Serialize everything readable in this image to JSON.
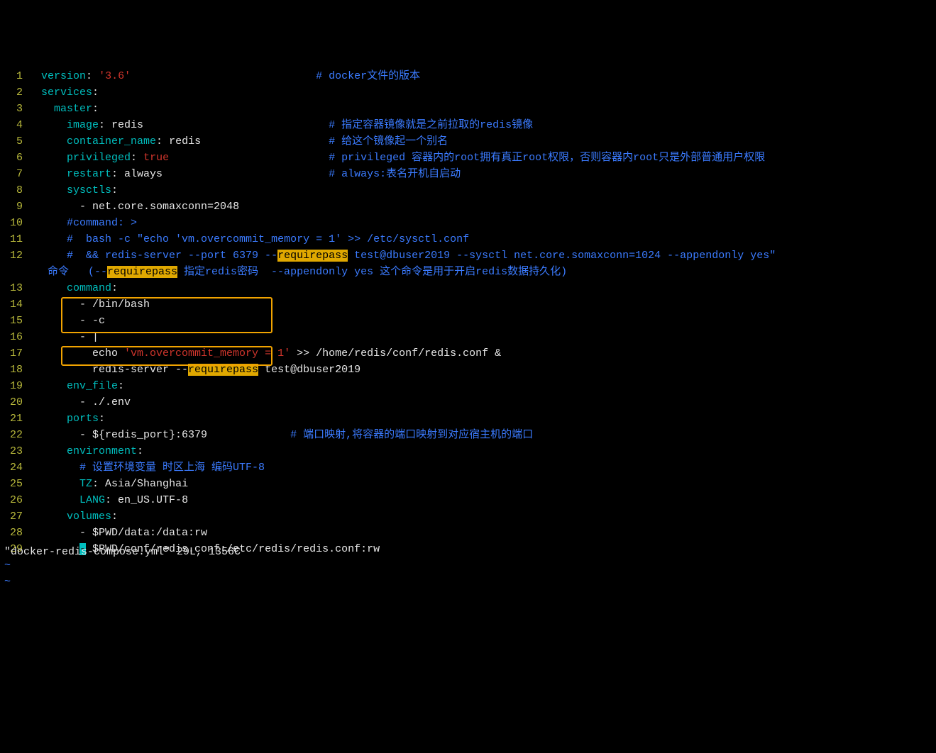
{
  "status_line": "\"docker-redis-compose.yml\" 29L, 1356C",
  "lines": [
    {
      "n": 1,
      "segs": [
        {
          "t": "  ",
          "c": "val"
        },
        {
          "t": "version",
          "c": "key"
        },
        {
          "t": ":",
          "c": "punct"
        },
        {
          "t": " ",
          "c": "val"
        },
        {
          "t": "'3.6'",
          "c": "str"
        },
        {
          "t": "                             ",
          "c": "val"
        },
        {
          "t": "# docker文件的版本",
          "c": "cmt"
        }
      ]
    },
    {
      "n": 2,
      "segs": [
        {
          "t": "  ",
          "c": "val"
        },
        {
          "t": "services",
          "c": "key"
        },
        {
          "t": ":",
          "c": "punct"
        }
      ]
    },
    {
      "n": 3,
      "segs": [
        {
          "t": "    ",
          "c": "val"
        },
        {
          "t": "master",
          "c": "key"
        },
        {
          "t": ":",
          "c": "punct"
        }
      ]
    },
    {
      "n": 4,
      "segs": [
        {
          "t": "      ",
          "c": "val"
        },
        {
          "t": "image",
          "c": "key"
        },
        {
          "t": ":",
          "c": "punct"
        },
        {
          "t": " redis",
          "c": "val"
        },
        {
          "t": "                             ",
          "c": "val"
        },
        {
          "t": "# 指定容器镜像就是之前拉取的redis镜像",
          "c": "cmt"
        }
      ]
    },
    {
      "n": 5,
      "segs": [
        {
          "t": "      ",
          "c": "val"
        },
        {
          "t": "container_name",
          "c": "key"
        },
        {
          "t": ":",
          "c": "punct"
        },
        {
          "t": " redis",
          "c": "val"
        },
        {
          "t": "                    ",
          "c": "val"
        },
        {
          "t": "# 给这个镜像起一个别名",
          "c": "cmt"
        }
      ]
    },
    {
      "n": 6,
      "segs": [
        {
          "t": "      ",
          "c": "val"
        },
        {
          "t": "privileged",
          "c": "key"
        },
        {
          "t": ":",
          "c": "punct"
        },
        {
          "t": " ",
          "c": "val"
        },
        {
          "t": "true",
          "c": "boolean"
        },
        {
          "t": "                         ",
          "c": "val"
        },
        {
          "t": "# privileged 容器内的root拥有真正root权限，否则容器内root只是外部普通用户权限",
          "c": "cmt"
        }
      ]
    },
    {
      "n": 7,
      "segs": [
        {
          "t": "      ",
          "c": "val"
        },
        {
          "t": "restart",
          "c": "key"
        },
        {
          "t": ":",
          "c": "punct"
        },
        {
          "t": " always",
          "c": "val"
        },
        {
          "t": "                          ",
          "c": "val"
        },
        {
          "t": "# always:表名开机自启动",
          "c": "cmt"
        }
      ]
    },
    {
      "n": 8,
      "segs": [
        {
          "t": "      ",
          "c": "val"
        },
        {
          "t": "sysctls",
          "c": "key"
        },
        {
          "t": ":",
          "c": "punct"
        }
      ]
    },
    {
      "n": 9,
      "segs": [
        {
          "t": "        ",
          "c": "val"
        },
        {
          "t": "-",
          "c": "dash"
        },
        {
          "t": " net.core.somaxconn=2048",
          "c": "val"
        }
      ]
    },
    {
      "n": 10,
      "segs": [
        {
          "t": "      ",
          "c": "val"
        },
        {
          "t": "#command: >",
          "c": "cmt"
        }
      ]
    },
    {
      "n": 11,
      "segs": [
        {
          "t": "      ",
          "c": "val"
        },
        {
          "t": "#  bash -c \"echo 'vm.overcommit_memory = 1' >> /etc/sysctl.conf",
          "c": "cmt"
        }
      ]
    },
    {
      "n": 12,
      "wrap": true,
      "segs": [
        {
          "t": "      ",
          "c": "val"
        },
        {
          "t": "#  && redis-server --port 6379 --",
          "c": "cmt"
        },
        {
          "t": "requirepass",
          "c": "hl"
        },
        {
          "t": " test@dbuser2019 --sysctl net.core.somaxconn=1024 --appendonly yes\"",
          "c": "cmt"
        }
      ]
    },
    {
      "n": null,
      "segs": [
        {
          "t": "   命令   (--",
          "c": "cmt"
        },
        {
          "t": "requirepass",
          "c": "hl"
        },
        {
          "t": " 指定redis密码  --appendonly yes 这个命令是用于开启redis数据持久化)",
          "c": "cmt"
        }
      ]
    },
    {
      "n": 13,
      "segs": [
        {
          "t": "      ",
          "c": "val"
        },
        {
          "t": "command",
          "c": "key"
        },
        {
          "t": ":",
          "c": "punct"
        }
      ]
    },
    {
      "n": 14,
      "segs": [
        {
          "t": "        ",
          "c": "val"
        },
        {
          "t": "-",
          "c": "dash"
        },
        {
          "t": " /bin/bash",
          "c": "val"
        }
      ]
    },
    {
      "n": 15,
      "segs": [
        {
          "t": "        ",
          "c": "val"
        },
        {
          "t": "-",
          "c": "dash"
        },
        {
          "t": " -c",
          "c": "val"
        }
      ]
    },
    {
      "n": 16,
      "segs": [
        {
          "t": "        ",
          "c": "val"
        },
        {
          "t": "-",
          "c": "dash"
        },
        {
          "t": " |",
          "c": "val"
        }
      ]
    },
    {
      "n": 17,
      "segs": [
        {
          "t": "          echo ",
          "c": "val"
        },
        {
          "t": "'vm.overcommit_memory = 1'",
          "c": "str"
        },
        {
          "t": " >> /home/redis/conf/redis.conf &",
          "c": "val"
        }
      ]
    },
    {
      "n": 18,
      "segs": [
        {
          "t": "          redis-server --",
          "c": "val"
        },
        {
          "t": "requirepass",
          "c": "hl"
        },
        {
          "t": " test@dbuser2019",
          "c": "val"
        }
      ]
    },
    {
      "n": 19,
      "segs": [
        {
          "t": "      ",
          "c": "val"
        },
        {
          "t": "env_file",
          "c": "key"
        },
        {
          "t": ":",
          "c": "punct"
        }
      ]
    },
    {
      "n": 20,
      "segs": [
        {
          "t": "        ",
          "c": "val"
        },
        {
          "t": "-",
          "c": "dash"
        },
        {
          "t": " ./.env",
          "c": "val"
        }
      ]
    },
    {
      "n": 21,
      "segs": [
        {
          "t": "      ",
          "c": "val"
        },
        {
          "t": "ports",
          "c": "key"
        },
        {
          "t": ":",
          "c": "punct"
        }
      ]
    },
    {
      "n": 22,
      "segs": [
        {
          "t": "        ",
          "c": "val"
        },
        {
          "t": "-",
          "c": "dash"
        },
        {
          "t": " ${redis_port}:6379",
          "c": "val"
        },
        {
          "t": "             ",
          "c": "val"
        },
        {
          "t": "# 端口映射,将容器的端口映射到对应宿主机的端口",
          "c": "cmt"
        }
      ]
    },
    {
      "n": 23,
      "segs": [
        {
          "t": "      ",
          "c": "val"
        },
        {
          "t": "environment",
          "c": "key"
        },
        {
          "t": ":",
          "c": "punct"
        }
      ]
    },
    {
      "n": 24,
      "segs": [
        {
          "t": "        ",
          "c": "val"
        },
        {
          "t": "# 设置环境变量 时区上海 编码UTF-8",
          "c": "cmt"
        }
      ]
    },
    {
      "n": 25,
      "segs": [
        {
          "t": "        ",
          "c": "val"
        },
        {
          "t": "TZ",
          "c": "key"
        },
        {
          "t": ":",
          "c": "punct"
        },
        {
          "t": " Asia/Shanghai",
          "c": "val"
        }
      ]
    },
    {
      "n": 26,
      "segs": [
        {
          "t": "        ",
          "c": "val"
        },
        {
          "t": "LANG",
          "c": "key"
        },
        {
          "t": ":",
          "c": "punct"
        },
        {
          "t": " en_US.UTF-8",
          "c": "val"
        }
      ]
    },
    {
      "n": 27,
      "segs": [
        {
          "t": "      ",
          "c": "val"
        },
        {
          "t": "volumes",
          "c": "key"
        },
        {
          "t": ":",
          "c": "punct"
        }
      ]
    },
    {
      "n": 28,
      "segs": [
        {
          "t": "        ",
          "c": "val"
        },
        {
          "t": "-",
          "c": "dash"
        },
        {
          "t": " $PWD/data:/data:rw",
          "c": "val"
        }
      ]
    },
    {
      "n": 29,
      "segs": [
        {
          "t": "        ",
          "c": "val"
        },
        {
          "t": "-",
          "c": "cursor-block"
        },
        {
          "t": " $PWD/conf/redis.conf:/etc/redis/redis.conf:rw",
          "c": "val"
        }
      ]
    }
  ],
  "tilde_rows": 2
}
